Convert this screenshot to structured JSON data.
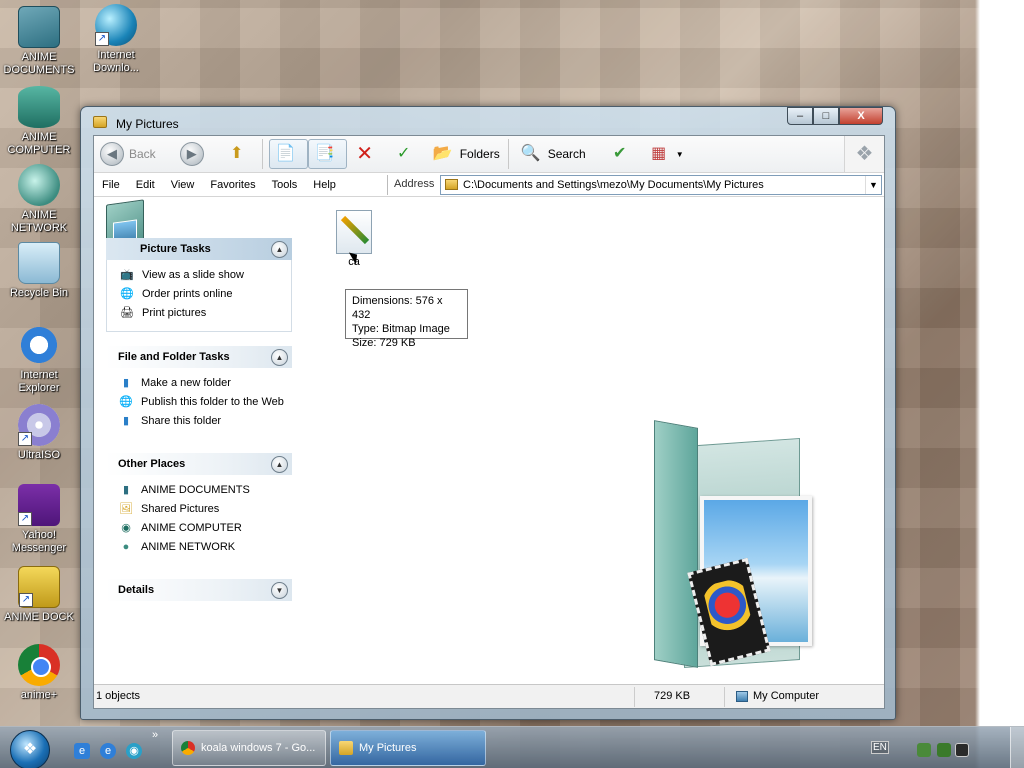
{
  "desktop": {
    "icons": [
      {
        "label": "ANIME DOCUMENTS",
        "icon": "folder-icon"
      },
      {
        "label": "Internet Downlo...",
        "icon": "idm-icon"
      },
      {
        "label": "ANIME COMPUTER",
        "icon": "computer-icon"
      },
      {
        "label": "ANIME NETWORK",
        "icon": "network-icon"
      },
      {
        "label": "Recycle Bin",
        "icon": "recycle-bin-icon"
      },
      {
        "label": "Internet Explorer",
        "icon": "ie-icon"
      },
      {
        "label": "UltraISO",
        "icon": "disc-icon"
      },
      {
        "label": "Yahoo! Messenger",
        "icon": "yahoo-icon"
      },
      {
        "label": "ANIME DOCK",
        "icon": "dock-icon"
      },
      {
        "label": "anime+",
        "icon": "chrome-icon"
      }
    ]
  },
  "window": {
    "title": "My Pictures",
    "controls": {
      "minimize": "–",
      "maximize": "□",
      "close": "X"
    }
  },
  "toolbar": {
    "back_label": "Back",
    "folders_label": "Folders",
    "search_label": "Search"
  },
  "menu": [
    "File",
    "Edit",
    "View",
    "Favorites",
    "Tools",
    "Help"
  ],
  "address": {
    "label": "Address",
    "path": "C:\\Documents and Settings\\mezo\\My Documents\\My Pictures"
  },
  "panels": {
    "picture_tasks": {
      "title": "Picture Tasks",
      "items": [
        "View as a slide show",
        "Order prints online",
        "Print pictures"
      ]
    },
    "file_folder_tasks": {
      "title": "File and Folder Tasks",
      "items": [
        "Make a new folder",
        "Publish this folder to the Web",
        "Share this folder"
      ]
    },
    "other_places": {
      "title": "Other Places",
      "items": [
        "ANIME DOCUMENTS",
        "Shared Pictures",
        "ANIME COMPUTER",
        "ANIME NETWORK"
      ]
    },
    "details": {
      "title": "Details"
    }
  },
  "file": {
    "name": "ca",
    "tooltip": {
      "dimensions": "Dimensions: 576 x 432",
      "type": "Type: Bitmap Image",
      "size": "Size: 729 KB"
    }
  },
  "status": {
    "objects": "1 objects",
    "size": "729 KB",
    "location": "My Computer"
  },
  "taskbar": {
    "buttons": [
      {
        "label": "koala windows 7 - Go...",
        "active": false
      },
      {
        "label": "My Pictures",
        "active": true
      }
    ],
    "language": "EN",
    "quick_more": "»"
  },
  "colors": {
    "panel_header_highlight": "#b8cee0",
    "taskbar_active": "#2864aa"
  }
}
